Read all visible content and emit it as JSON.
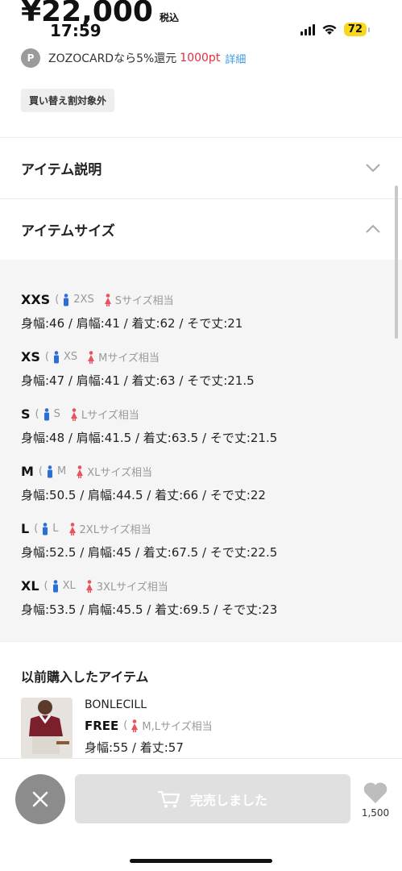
{
  "price": {
    "value": "¥22,000",
    "tax_label": "税込"
  },
  "status_bar": {
    "time": "17:59",
    "battery": "72"
  },
  "card": {
    "icon_letter": "P",
    "text": "ZOZOCARDなら5%還元",
    "points": "1000pt",
    "detail_link": "詳細"
  },
  "tag": "買い替え割対象外",
  "accordions": {
    "description": {
      "title": "アイテム説明"
    },
    "size": {
      "title": "アイテムサイズ"
    }
  },
  "sizes": [
    {
      "name": "XXS",
      "male": "2XS",
      "female": "Sサイズ相当",
      "dims": "身幅:46 / 肩幅:41 / 着丈:62 / そで丈:21"
    },
    {
      "name": "XS",
      "male": "XS",
      "female": "Mサイズ相当",
      "dims": "身幅:47 / 肩幅:41 / 着丈:63 / そで丈:21.5"
    },
    {
      "name": "S",
      "male": "S",
      "female": "Lサイズ相当",
      "dims": "身幅:48 / 肩幅:41.5 / 着丈:63.5 / そで丈:21.5"
    },
    {
      "name": "M",
      "male": "M",
      "female": "XLサイズ相当",
      "dims": "身幅:50.5 / 肩幅:44.5 / 着丈:66 / そで丈:22"
    },
    {
      "name": "L",
      "male": "L",
      "female": "2XLサイズ相当",
      "dims": "身幅:52.5 / 肩幅:45 / 着丈:67.5 / そで丈:22.5"
    },
    {
      "name": "XL",
      "male": "XL",
      "female": "3XLサイズ相当",
      "dims": "身幅:53.5 / 肩幅:45.5 / 着丈:69.5 / そで丈:23"
    }
  ],
  "previous": {
    "title": "以前購入したアイテム",
    "brand": "BONLECILL",
    "size_name": "FREE",
    "female": "M,Lサイズ相当",
    "dims": "身幅:55 / 着丈:57"
  },
  "bottom": {
    "soldout_label": "完売しました",
    "fav_count": "1,500"
  },
  "colors": {
    "accent_red": "#e32d3c",
    "link_blue": "#3a9ae0",
    "male_blue": "#2a6fd6",
    "female_red": "#e8545e"
  },
  "icons": [
    "chevron-down-icon",
    "chevron-up-icon",
    "close-icon",
    "cart-icon",
    "heart-icon",
    "male-icon",
    "female-icon",
    "wifi-icon",
    "signal-icon",
    "battery-icon"
  ]
}
